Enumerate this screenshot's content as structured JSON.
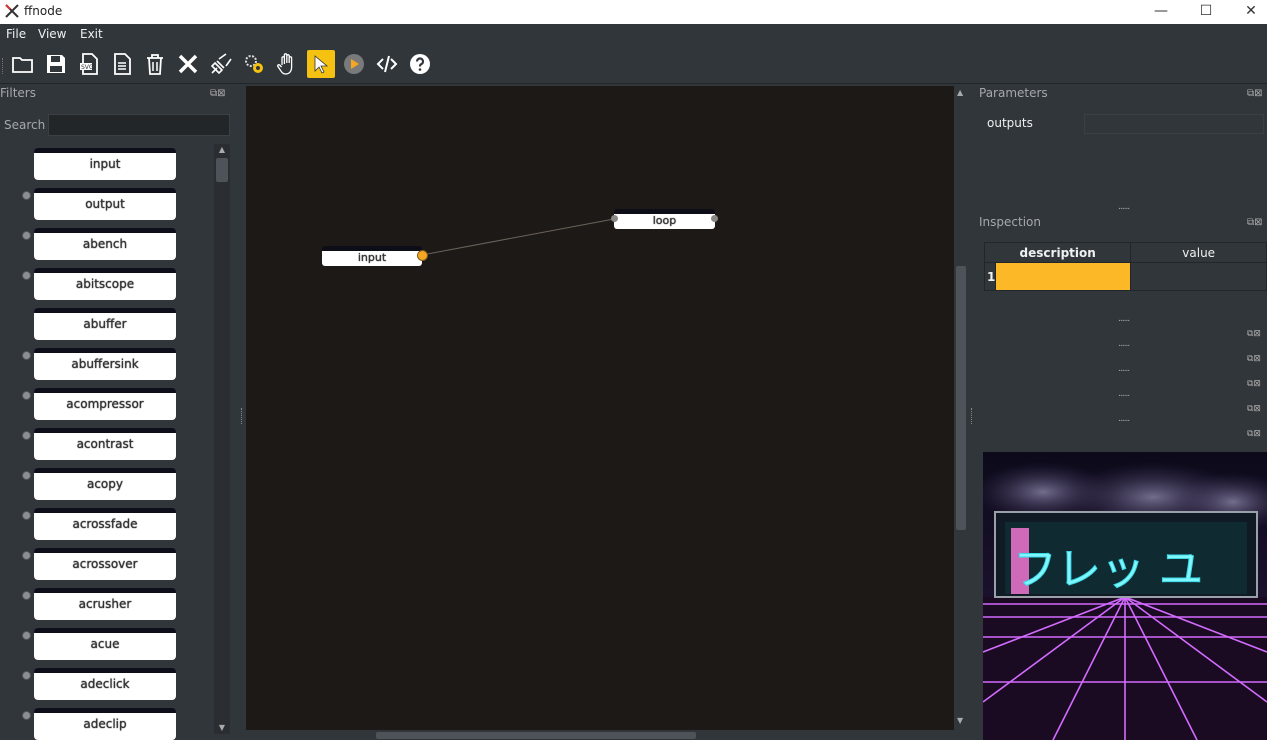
{
  "window": {
    "title": "ffnode",
    "min": "—",
    "max": "☐",
    "close": "✕"
  },
  "menu": {
    "file": "File",
    "view": "View",
    "exit": "Exit"
  },
  "toolbar": {
    "icons": [
      "open-folder-icon",
      "save-icon",
      "export-icon",
      "document-icon",
      "trash-icon",
      "close-x-icon",
      "plug-icon",
      "gears-icon",
      "hand-icon",
      "select-arrow-icon",
      "play-icon",
      "code-icon",
      "help-icon"
    ],
    "active": "select-arrow-icon",
    "accent": "#f5c211"
  },
  "filters": {
    "title": "Filters",
    "search_label": "Search",
    "search_placeholder": "",
    "items": [
      "input",
      "output",
      "abench",
      "abitscope",
      "abuffer",
      "abuffersink",
      "acompressor",
      "acontrast",
      "acopy",
      "acrossfade",
      "acrossover",
      "acrusher",
      "acue",
      "adeclick",
      "adeclip"
    ]
  },
  "canvas": {
    "background": "#1d1917",
    "nodes": [
      {
        "label": "input"
      },
      {
        "label": "loop"
      }
    ]
  },
  "parameters": {
    "title": "Parameters",
    "outputs_label": "outputs",
    "outputs_value": ""
  },
  "inspection": {
    "title": "Inspection",
    "col_description": "description",
    "col_value": "value",
    "row_number": "1",
    "highlight": "#fdb827"
  },
  "preview": {
    "sign_text": "フレッ ユ"
  }
}
